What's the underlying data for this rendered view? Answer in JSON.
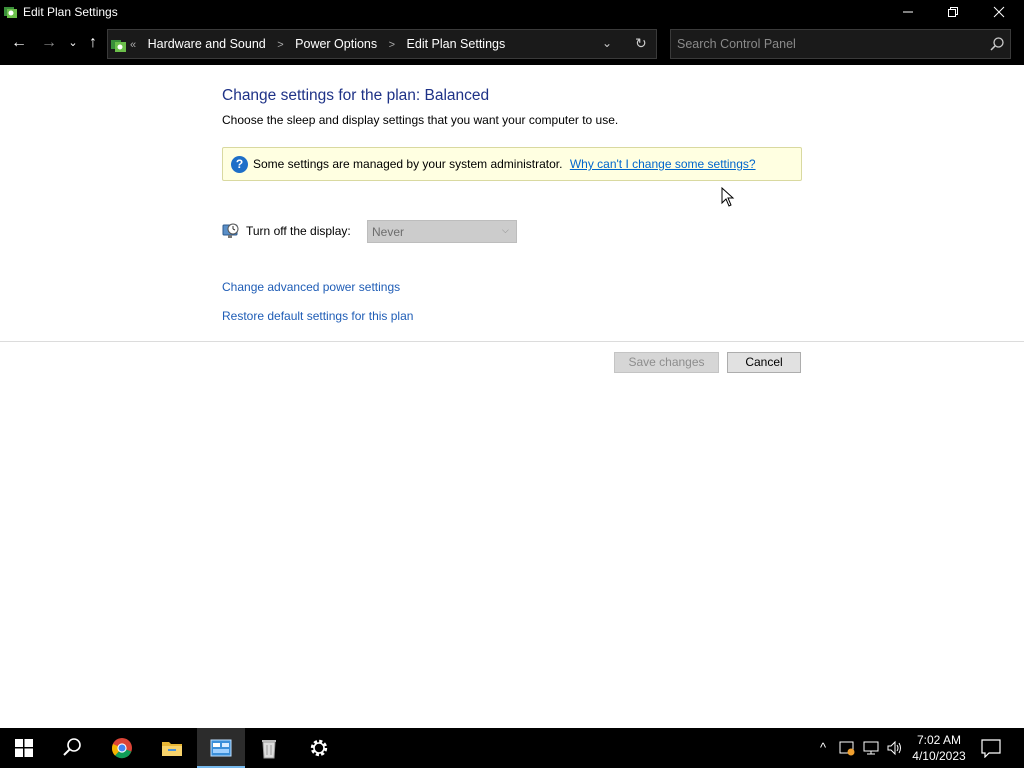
{
  "window": {
    "title": "Edit Plan Settings",
    "minimize_icon": "minimize-icon",
    "maximize_icon": "restore-icon",
    "close_icon": "close-icon"
  },
  "navigation": {
    "back": "←",
    "forward": "→",
    "recent": "⌄",
    "up": "↑",
    "breadcrumb_lead": "«",
    "breadcrumbs": [
      "Hardware and Sound",
      "Power Options",
      "Edit Plan Settings"
    ],
    "dropdown_glyph": "⌄",
    "refresh_glyph": "↻",
    "search_placeholder": "Search Control Panel"
  },
  "main": {
    "heading": "Change settings for the plan: Balanced",
    "subheading": "Choose the sleep and display settings that you want your computer to use.",
    "notice": {
      "icon": "?",
      "text": "Some settings are managed by your system administrator.",
      "link": "Why can't I change some settings?"
    },
    "display_setting": {
      "label": "Turn off the display:",
      "value": "Never",
      "chevron": "⌵"
    },
    "links": {
      "advanced": "Change advanced power settings",
      "restore": "Restore default settings for this plan"
    },
    "buttons": {
      "save": "Save changes",
      "cancel": "Cancel"
    }
  },
  "taskbar": {
    "items": [
      "start",
      "search",
      "chrome",
      "file-explorer",
      "control-panel",
      "recycle-bin",
      "settings"
    ],
    "active_item": "control-panel",
    "tray": {
      "chevron": "^",
      "time": "7:02 AM",
      "date": "4/10/2023"
    }
  },
  "colors": {
    "titlebar": "#000000",
    "heading": "#1e3287",
    "link": "#1f5db6",
    "notice_bg": "#ffffe1",
    "taskbar_active": "#76b9ed"
  }
}
